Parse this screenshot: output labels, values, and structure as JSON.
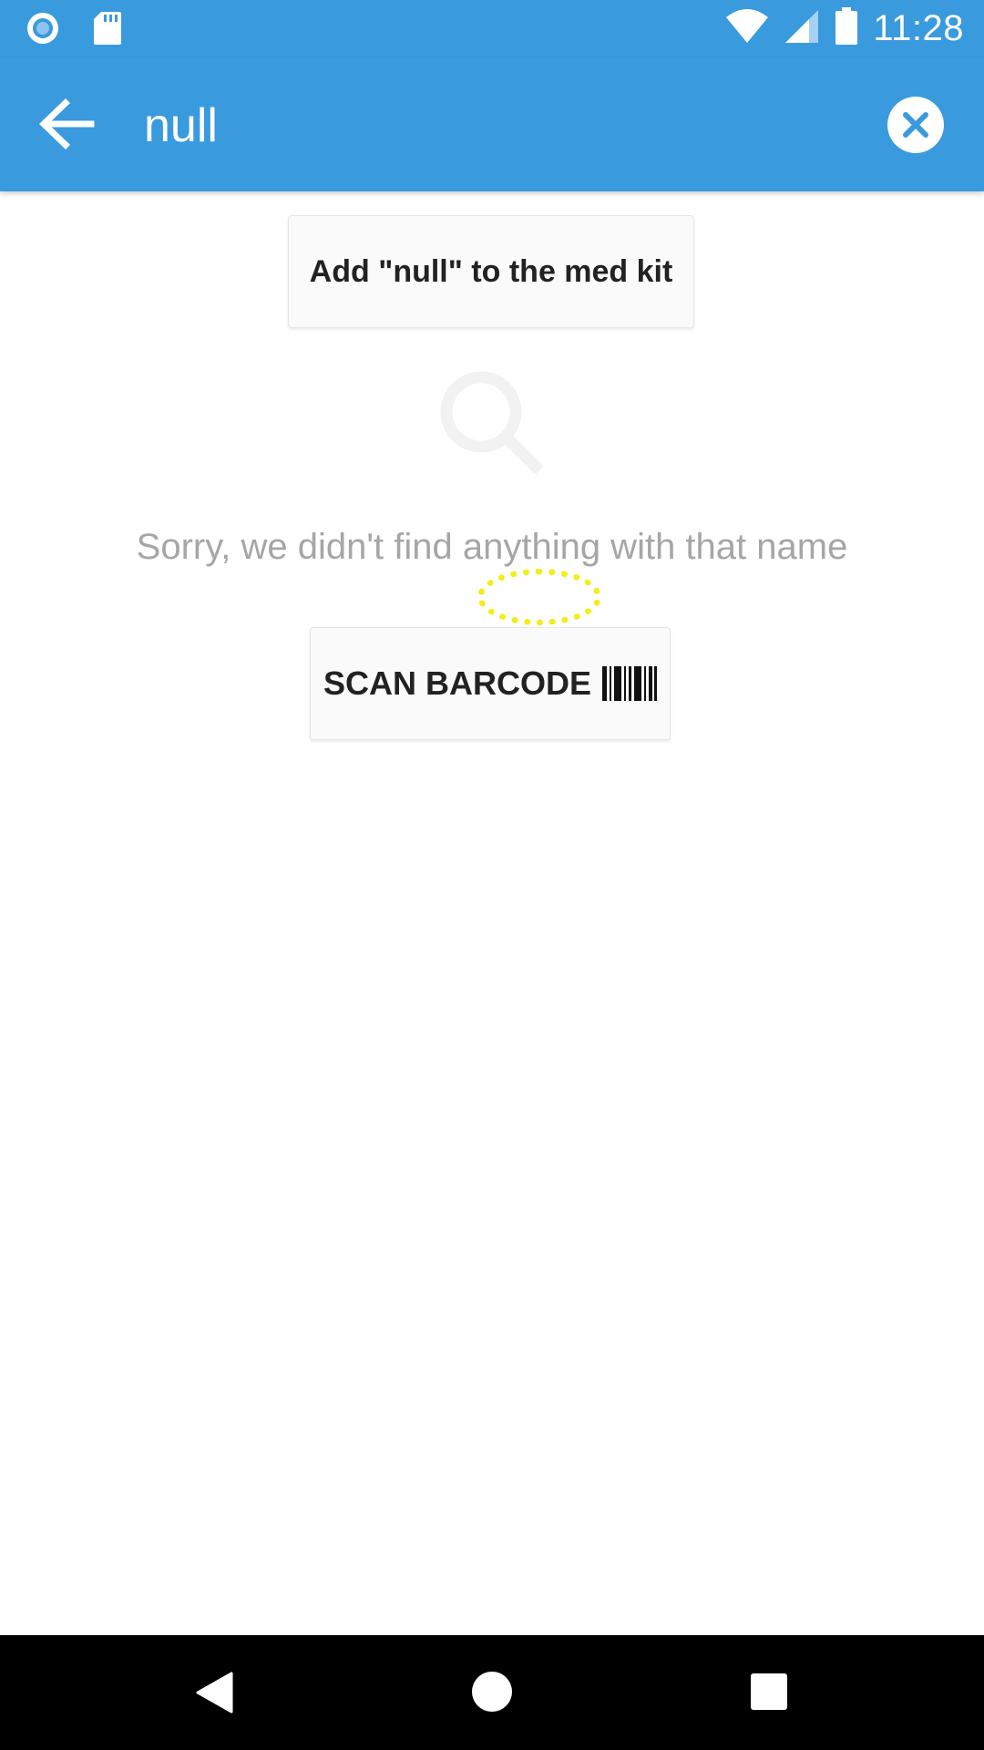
{
  "status_bar": {
    "time": "11:28",
    "icons": [
      "record-icon",
      "sd-card-icon",
      "wifi-icon",
      "cell-signal-icon",
      "battery-icon"
    ]
  },
  "app_bar": {
    "search_query": "null",
    "back_icon": "arrow-left-icon",
    "clear_icon": "close-circle-icon",
    "color": "#3a9ade"
  },
  "content": {
    "add_button_label": "Add \"null\" to the med kit",
    "empty_icon": "magnifier-icon",
    "empty_message": "Sorry, we didn't find anything with that name",
    "scan_button_label": "SCAN BARCODE",
    "scan_icon": "barcode-icon"
  },
  "nav_bar": {
    "buttons": [
      "back-triangle-icon",
      "home-circle-icon",
      "recents-square-icon"
    ]
  }
}
